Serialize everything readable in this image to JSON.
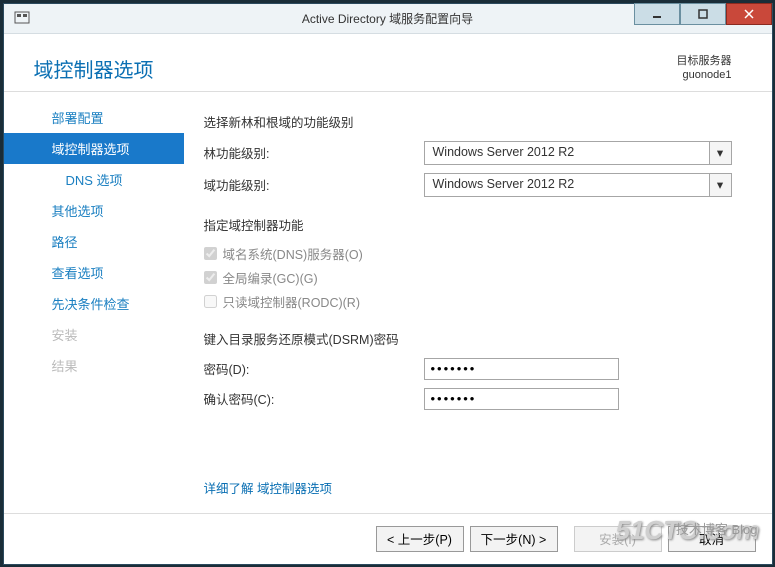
{
  "window": {
    "title": "Active Directory 域服务配置向导"
  },
  "header": {
    "page_title": "域控制器选项",
    "target_label": "目标服务器",
    "target_server": "guonode1"
  },
  "sidebar": {
    "items": [
      {
        "label": "部署配置",
        "state": "normal"
      },
      {
        "label": "域控制器选项",
        "state": "selected"
      },
      {
        "label": "DNS 选项",
        "state": "sub"
      },
      {
        "label": "其他选项",
        "state": "normal"
      },
      {
        "label": "路径",
        "state": "normal"
      },
      {
        "label": "查看选项",
        "state": "normal"
      },
      {
        "label": "先决条件检查",
        "state": "normal"
      },
      {
        "label": "安装",
        "state": "disabled"
      },
      {
        "label": "结果",
        "state": "disabled"
      }
    ]
  },
  "main": {
    "section1_title": "选择新林和根域的功能级别",
    "forest_level_label": "林功能级别:",
    "forest_level_value": "Windows Server 2012 R2",
    "domain_level_label": "域功能级别:",
    "domain_level_value": "Windows Server 2012 R2",
    "section2_title": "指定域控制器功能",
    "check_dns": "域名系统(DNS)服务器(O)",
    "check_gc": "全局编录(GC)(G)",
    "check_rodc": "只读域控制器(RODC)(R)",
    "section3_title": "键入目录服务还原模式(DSRM)密码",
    "password_label": "密码(D):",
    "password_value": "•••••••",
    "confirm_label": "确认密码(C):",
    "confirm_value": "•••••••",
    "more_link": "详细了解 域控制器选项"
  },
  "footer": {
    "prev": "< 上一步(P)",
    "next": "下一步(N) >",
    "install": "安装(I)",
    "cancel": "取消"
  },
  "watermark": {
    "main": "51CTO.com",
    "sub": "技术博客 Blog"
  }
}
